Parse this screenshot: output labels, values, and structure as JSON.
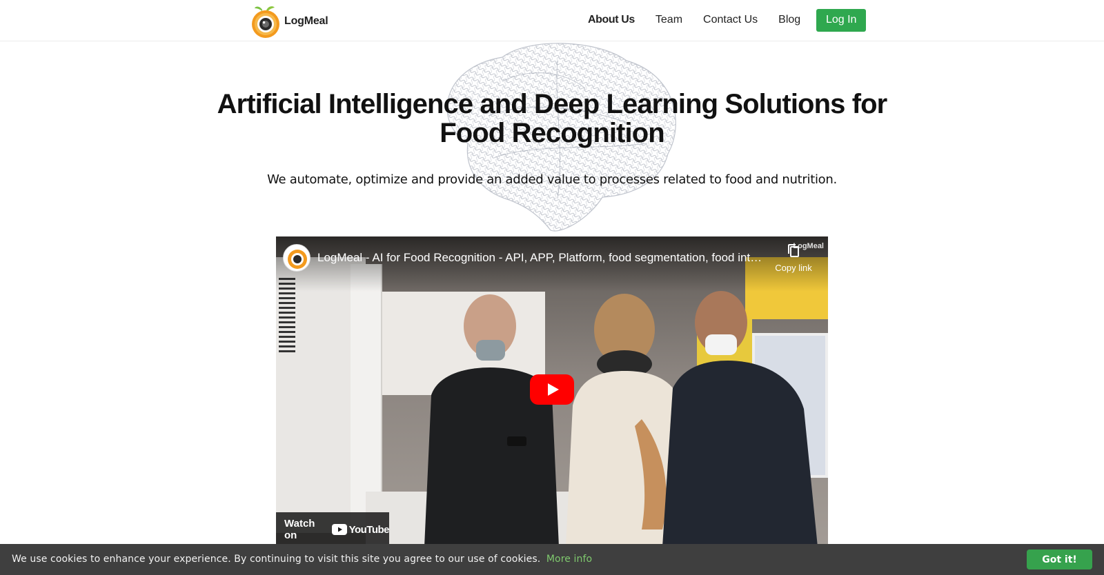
{
  "brand": {
    "name": "LogMeal"
  },
  "nav": {
    "items": [
      {
        "label": "About Us",
        "active": true
      },
      {
        "label": "Team"
      },
      {
        "label": "Contact Us"
      },
      {
        "label": "Blog"
      }
    ],
    "login_label": "Log In"
  },
  "hero": {
    "title": "Artificial Intelligence and Deep Learning Solutions for Food Recognition",
    "subtitle": "We automate, optimize and provide an added value to processes related to food and nutrition."
  },
  "video": {
    "title": "LogMeal - AI for Food Recognition - API, APP, Platform, food segmentation, food intak...",
    "copy_link_label": "Copy link",
    "watermark": "LogMeal",
    "watch_on_label": "Watch on",
    "youtube_label": "YouTube"
  },
  "cookie": {
    "text": "We use cookies to enhance your experience. By continuing to visit this site you agree to our use of cookies.",
    "more_info_label": "More info",
    "accept_label": "Got it!"
  },
  "colors": {
    "accent_green": "#2fa84f",
    "cookie_bar": "#3f3f3f",
    "cookie_link": "#7fc96e",
    "youtube_red": "#ff0000"
  },
  "icons": {
    "logo": "camera-in-orange-icon",
    "copy": "copy-link-icon",
    "play": "play-icon",
    "youtube": "youtube-logo-icon"
  }
}
